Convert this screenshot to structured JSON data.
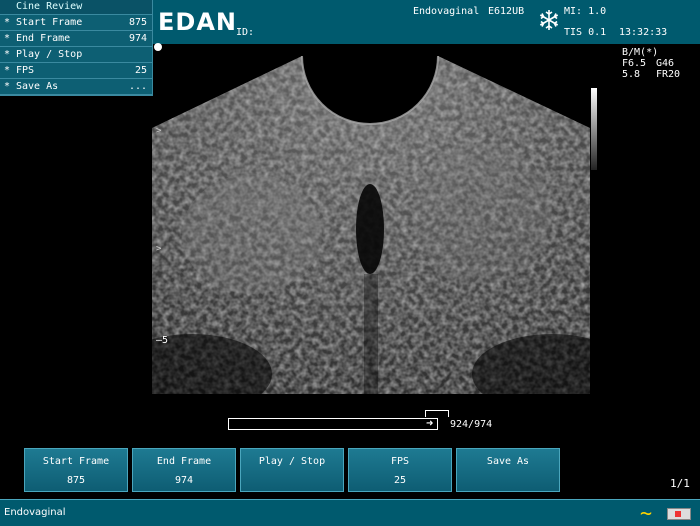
{
  "header": {
    "logo": "EDAN",
    "id_label": "ID:",
    "probe_mode": "Endovaginal",
    "probe_model": "E612UB",
    "mi": "MI: 1.0",
    "tis": "TIS 0.1",
    "time": "13:32:33"
  },
  "menu": {
    "title": "Cine Review",
    "items": [
      {
        "star": "*",
        "label": "Start Frame",
        "value": "875"
      },
      {
        "star": "*",
        "label": "End Frame",
        "value": "974"
      },
      {
        "star": "*",
        "label": "Play / Stop",
        "value": ""
      },
      {
        "star": "*",
        "label": "FPS",
        "value": "25"
      },
      {
        "star": "*",
        "label": "Save As",
        "value": "..."
      }
    ]
  },
  "imaging_params": {
    "mode": "B/M(*)",
    "f": "F6.5",
    "g": "G46",
    "depth": "5.8",
    "fr": "FR20"
  },
  "depth_marker": "5",
  "tick_marks": [
    ">",
    ">"
  ],
  "cine": {
    "counter": "924/974",
    "progress": 0.949
  },
  "softkeys": [
    {
      "label": "Start Frame",
      "value": "875"
    },
    {
      "label": "End Frame",
      "value": "974"
    },
    {
      "label": "Play / Stop",
      "value": ""
    },
    {
      "label": "FPS",
      "value": "25"
    },
    {
      "label": "Save As",
      "value": ""
    }
  ],
  "page_indicator": "1/1",
  "status": {
    "text": "Endovaginal"
  },
  "colors": {
    "header_bg": "#005a6e",
    "accent_yellow": "#ffd400"
  },
  "icons": [
    "snowflake-icon",
    "freeze-indicator-dot",
    "wave-icon",
    "battery-icon"
  ]
}
